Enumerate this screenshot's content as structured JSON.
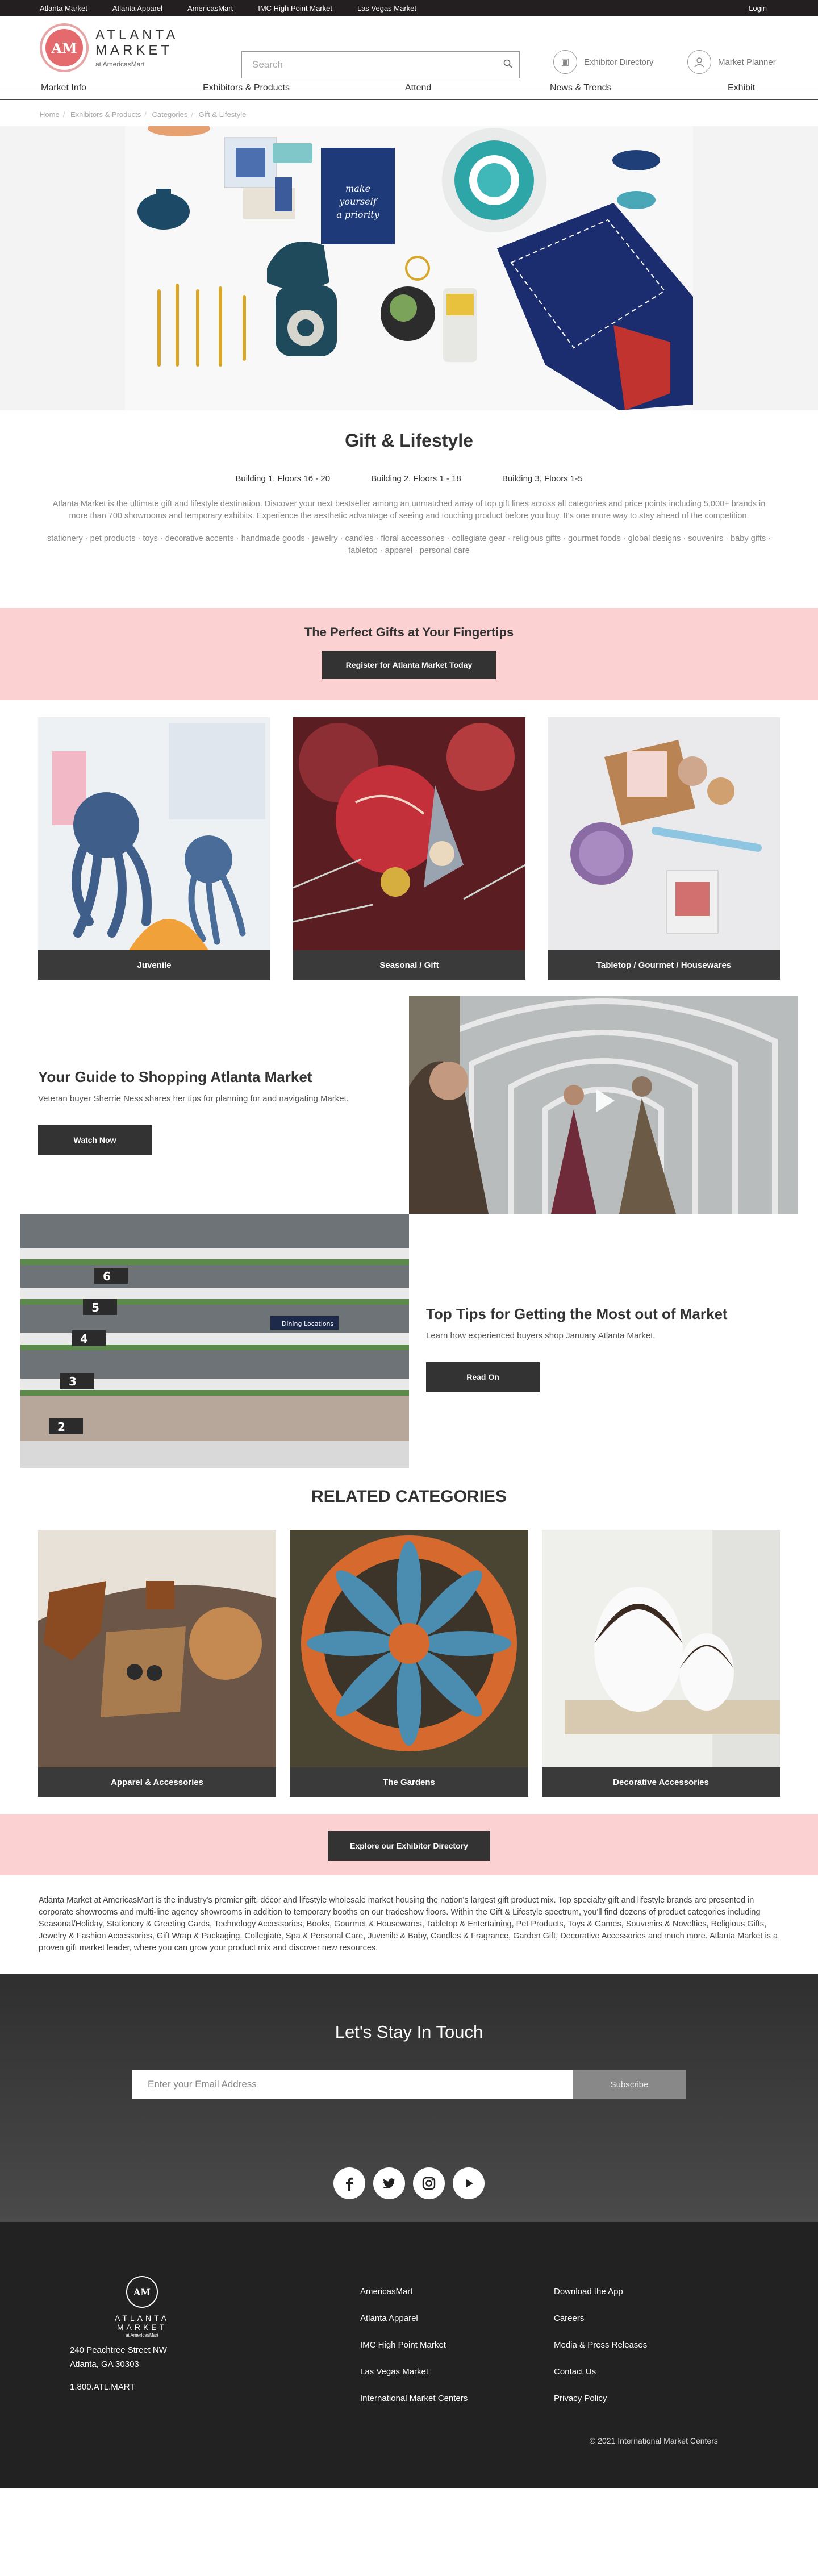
{
  "topbar": {
    "links": [
      "Atlanta Market",
      "Atlanta Apparel",
      "AmericasMart",
      "IMC High Point Market",
      "Las Vegas Market"
    ],
    "login": "Login"
  },
  "header": {
    "logo_mark": "AM",
    "logo_title": "ATLANTA MARKET",
    "logo_sub": "at AmericasMart",
    "search_placeholder": "Search",
    "exhibitor_directory": "Exhibitor Directory",
    "market_planner": "Market Planner"
  },
  "nav": [
    "Market Info",
    "Exhibitors & Products",
    "Attend",
    "News & Trends",
    "Exhibit"
  ],
  "breadcrumb": [
    "Home",
    "Exhibitors & Products",
    "Categories",
    "Gift & Lifestyle"
  ],
  "intro": {
    "title": "Gift & Lifestyle",
    "buildings": [
      "Building 1, Floors 16 - 20",
      "Building 2, Floors 1 - 18",
      "Building 3, Floors 1-5"
    ],
    "description": "Atlanta Market is the ultimate gift and lifestyle destination. Discover your next bestseller among an unmatched array of top gift lines across all categories and price points including 5,000+ brands in more than 700 showrooms and temporary exhibits. Experience the aesthetic advantage of seeing and touching product before you buy. It's one more way to stay ahead of the competition.",
    "tags": "stationery · pet products · toys · decorative accents · handmade goods · jewelry · candles · floral accessories · collegiate gear · religious gifts · gourmet foods · global designs · souvenirs · baby gifts · tabletop · apparel · personal care"
  },
  "promo": {
    "title": "The Perfect Gifts at Your Fingertips",
    "button": "Register for Atlanta Market Today"
  },
  "category_cards": [
    "Juvenile",
    "Seasonal / Gift",
    "Tabletop / Gourmet / Housewares"
  ],
  "guide": {
    "title": "Your Guide to Shopping Atlanta Market",
    "text": "Veteran buyer Sherrie Ness shares her tips for planning for and navigating Market.",
    "button": "Watch Now"
  },
  "tips": {
    "title": "Top Tips for Getting the Most out of Market",
    "text": "Learn how experienced buyers shop January Atlanta Market.",
    "button": "Read On",
    "signs": [
      "6",
      "5",
      "4",
      "3",
      "2"
    ],
    "dining_sign": "Dining Locations"
  },
  "related": {
    "title": "RELATED CATEGORIES",
    "cards": [
      "Apparel & Accessories",
      "The Gardens",
      "Decorative Accessories"
    ]
  },
  "promo2": {
    "button": "Explore our Exhibitor Directory"
  },
  "about": "Atlanta Market at AmericasMart is the industry's premier gift, décor and lifestyle wholesale market housing the nation's largest gift product mix. Top specialty gift and lifestyle brands are presented in corporate showrooms and multi-line agency showrooms in addition to temporary booths on our tradeshow floors. Within the Gift & Lifestyle spectrum, you'll find dozens of product categories including Seasonal/Holiday, Stationery & Greeting Cards, Technology Accessories, Books, Gourmet & Housewares, Tabletop & Entertaining, Pet Products, Toys & Games, Souvenirs & Novelties, Religious Gifts, Jewelry & Fashion Accessories, Gift Wrap & Packaging, Collegiate, Spa & Personal Care, Juvenile & Baby, Candles & Fragrance, Garden Gift, Decorative Accessories and much more. Atlanta Market is a proven gift market leader, where you can grow your product mix and discover new resources.",
  "newsletter": {
    "title": "Let's Stay In Touch",
    "placeholder": "Enter your Email Address",
    "button": "Subscribe"
  },
  "socials": [
    "facebook-icon",
    "twitter-icon",
    "instagram-icon",
    "youtube-icon"
  ],
  "footer": {
    "logo_mark": "AM",
    "logo_title": "ATLANTA MARKET",
    "logo_sub": "at AmericasMart",
    "address_1": "240 Peachtree Street NW",
    "address_2": "Atlanta, GA 30303",
    "phone": "1.800.ATL.MART",
    "col1": [
      "AmericasMart",
      "Atlanta Apparel",
      "IMC High Point Market",
      "Las Vegas Market",
      "International Market Centers"
    ],
    "col2": [
      "Download the App",
      "Careers",
      "Media & Press Releases",
      "Contact Us",
      "Privacy Policy"
    ],
    "copyright": "© 2021 International Market Centers"
  },
  "colors": {
    "pink_band": "#fbd1d1",
    "dark_button": "#333333",
    "logo_red": "#e56a6d",
    "footer_bg": "#222222"
  }
}
